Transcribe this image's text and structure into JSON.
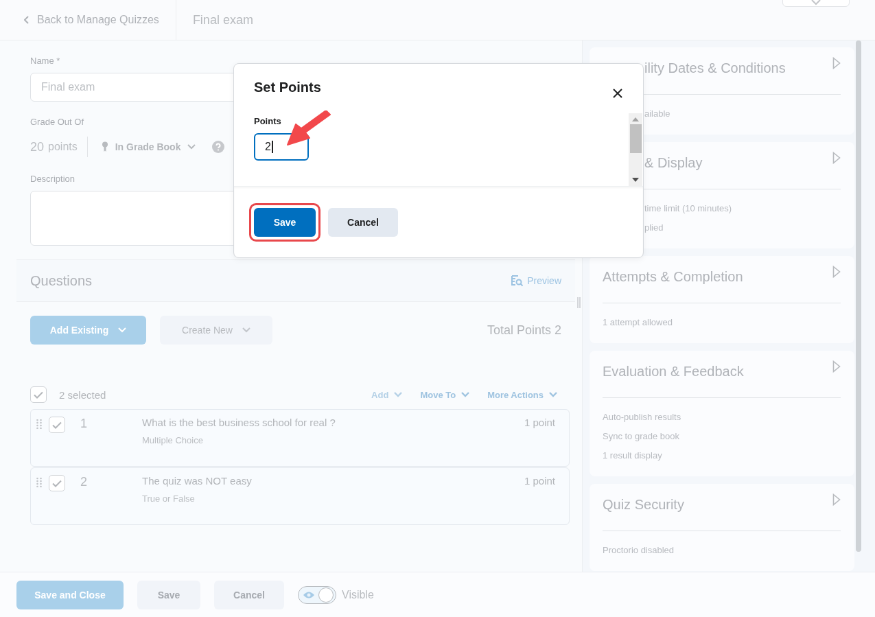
{
  "header": {
    "back_link": "Back to Manage Quizzes",
    "title": "Final exam"
  },
  "form": {
    "name_label": "Name *",
    "name_value": "Final exam",
    "grade_label": "Grade Out Of",
    "grade_value": "20",
    "grade_unit": "points",
    "grade_book": "In Grade Book",
    "description_label": "Description"
  },
  "questions": {
    "title": "Questions",
    "preview": "Preview",
    "add_existing": "Add Existing",
    "create_new": "Create New",
    "total_points": "Total Points 2",
    "select_all_checked": true,
    "selected_count": "2 selected",
    "actions": [
      {
        "label": "Add",
        "disabled": true
      },
      {
        "label": "Move To",
        "disabled": false
      },
      {
        "label": "More Actions",
        "disabled": false
      }
    ],
    "items": [
      {
        "number": "1",
        "text": "What is the best business school for real ?",
        "type": "Multiple Choice",
        "points": "1 point",
        "checked": true
      },
      {
        "number": "2",
        "text": "The quiz was NOT easy",
        "type": "True or False",
        "points": "1 point",
        "checked": true
      }
    ]
  },
  "settings_cards": [
    {
      "title": "ility Dates & Conditions",
      "lines": [
        "ailable"
      ]
    },
    {
      "title": "& Display",
      "lines": [
        "time limit (10 minutes)",
        "plied"
      ]
    },
    {
      "title": "Attempts & Completion",
      "lines": [
        "1 attempt allowed"
      ]
    },
    {
      "title": "Evaluation & Feedback",
      "lines": [
        "Auto-publish results",
        "Sync to grade book",
        "1 result display"
      ]
    },
    {
      "title": "Quiz Security",
      "lines": [
        "Proctorio disabled"
      ]
    }
  ],
  "footer": {
    "buttons": [
      {
        "label": "Save and Close",
        "kind": "primary"
      },
      {
        "label": "Save",
        "kind": "secondary"
      },
      {
        "label": "Cancel",
        "kind": "secondary"
      }
    ],
    "visible_on": true,
    "visible_label": "Visible"
  },
  "dialog": {
    "title": "Set Points",
    "field_label": "Points",
    "value": "2",
    "buttons": [
      {
        "label": "Save",
        "kind": "primary",
        "highlighted": true
      },
      {
        "label": "Cancel",
        "kind": "secondary",
        "highlighted": false
      }
    ]
  }
}
